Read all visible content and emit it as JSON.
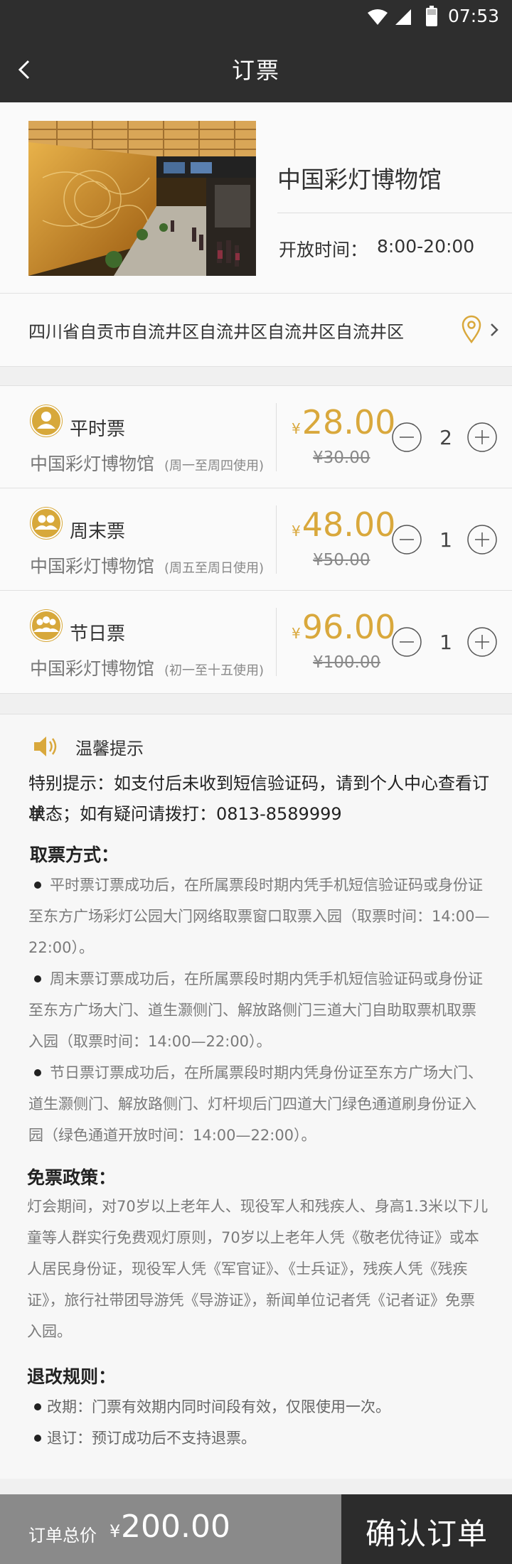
{
  "status_bar": {
    "time": "07:53"
  },
  "header": {
    "title": "订票"
  },
  "venue": {
    "name": "中国彩灯博物馆",
    "hours_label": "开放时间：",
    "hours_value": "8:00-20:00"
  },
  "address": {
    "text": "四川省自贡市自流井区自流井区自流井区自流井区"
  },
  "tickets": [
    {
      "name": "平时票",
      "venue": "中国彩灯博物馆",
      "note": "(周一至周四使用)",
      "currency": "¥",
      "price": "28.00",
      "original_price": "¥30.00",
      "quantity": "2",
      "icon": "single-person-icon"
    },
    {
      "name": "周末票",
      "venue": "中国彩灯博物馆",
      "note": "(周五至周日使用)",
      "currency": "¥",
      "price": "48.00",
      "original_price": "¥50.00",
      "quantity": "1",
      "icon": "two-people-icon"
    },
    {
      "name": "节日票",
      "venue": "中国彩灯博物馆",
      "note": "(初一至十五使用)",
      "currency": "¥",
      "price": "96.00",
      "original_price": "¥100.00",
      "quantity": "1",
      "icon": "group-icon"
    }
  ],
  "tips": {
    "title": "温馨提示",
    "special_line1": "特别提示：如支付后未收到短信验证码，请到个人中心查看订单",
    "special_line2": "状态；如有疑问请拨打：0813-8589999",
    "pickup_heading": "取票方式：",
    "pickup": [
      {
        "lines": [
          "平时票订票成功后，在所属票段时期内凭手机短信验证码或身份证",
          "至东方广场彩灯公园大门网络取票窗口取票入园（取票时间：14:00—",
          "22:00）。"
        ]
      },
      {
        "lines": [
          "周末票订票成功后，在所属票段时期内凭手机短信验证码或身份证",
          "至东方广场大门、道生灏侧门、解放路侧门三道大门自助取票机取票",
          "入园（取票时间：14:00—22:00）。"
        ]
      },
      {
        "lines": [
          "节日票订票成功后，在所属票段时期内凭身份证至东方广场大门、",
          "道生灏侧门、解放路侧门、灯杆坝后门四道大门绿色通道刷身份证入",
          "园（绿色通道开放时间：14:00—22:00）。"
        ]
      }
    ],
    "free_heading": "免票政策：",
    "free_lines": [
      "灯会期间，对70岁以上老年人、现役军人和残疾人、身高1.3米以下儿",
      "童等人群实行免费观灯原则，70岁以上老年人凭《敬老优待证》或本",
      "人居民身份证，现役军人凭《军官证》、《士兵证》，残疾人凭《残疾",
      "证》，旅行社带团导游凭《导游证》，新闻单位记者凭《记者证》免票",
      "入园。"
    ],
    "refund_heading": "退改规则：",
    "refund": [
      "改期：门票有效期内同时间段有效，仅限使用一次。",
      "退订：预订成功后不支持退票。"
    ]
  },
  "footer": {
    "total_label": "订单总价",
    "currency": "¥",
    "total": "200.00",
    "confirm_label": "确认订单"
  },
  "colors": {
    "accent": "#d9a83c",
    "dark_bar": "#2e2e2e",
    "total_bar": "#8a8a8a",
    "confirm_bar": "#2c2c2c"
  }
}
